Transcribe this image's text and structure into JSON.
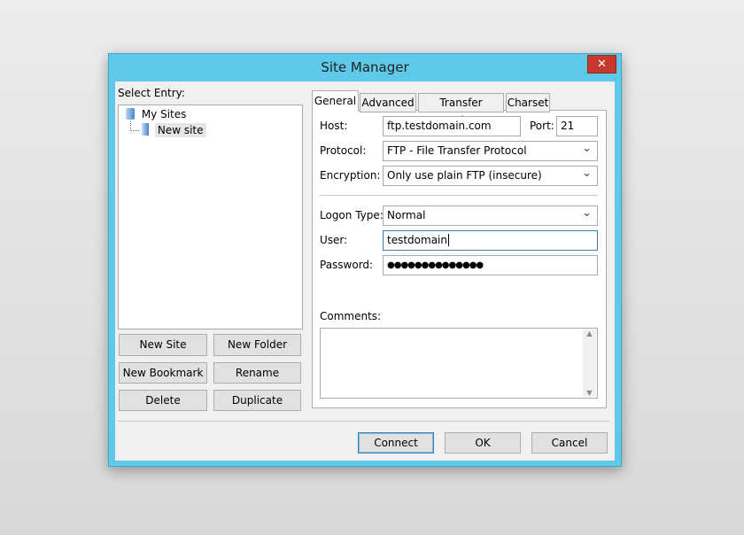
{
  "window": {
    "title": "Site Manager",
    "close_label": "✕"
  },
  "left": {
    "select_entry_label": "Select Entry:",
    "tree": [
      {
        "label": "My Sites"
      },
      {
        "label": "New site"
      }
    ],
    "buttons": {
      "new_site": "New Site",
      "new_folder": "New Folder",
      "new_bookmark": "New Bookmark",
      "rename": "Rename",
      "delete": "Delete",
      "duplicate": "Duplicate"
    }
  },
  "tabs": [
    {
      "label": "General"
    },
    {
      "label": "Advanced"
    },
    {
      "label": "Transfer Settings"
    },
    {
      "label": "Charset"
    }
  ],
  "general": {
    "host_label": "Host:",
    "host_value": "ftp.testdomain.com",
    "port_label": "Port:",
    "port_value": "21",
    "protocol_label": "Protocol:",
    "protocol_value": "FTP - File Transfer Protocol",
    "encryption_label": "Encryption:",
    "encryption_value": "Only use plain FTP (insecure)",
    "logon_label": "Logon Type:",
    "logon_value": "Normal",
    "user_label": "User:",
    "user_value": "testdomain",
    "password_label": "Password:",
    "password_value": "●●●●●●●●●●●●●●",
    "comments_label": "Comments:"
  },
  "footer": {
    "connect": "Connect",
    "ok": "OK",
    "cancel": "Cancel"
  }
}
